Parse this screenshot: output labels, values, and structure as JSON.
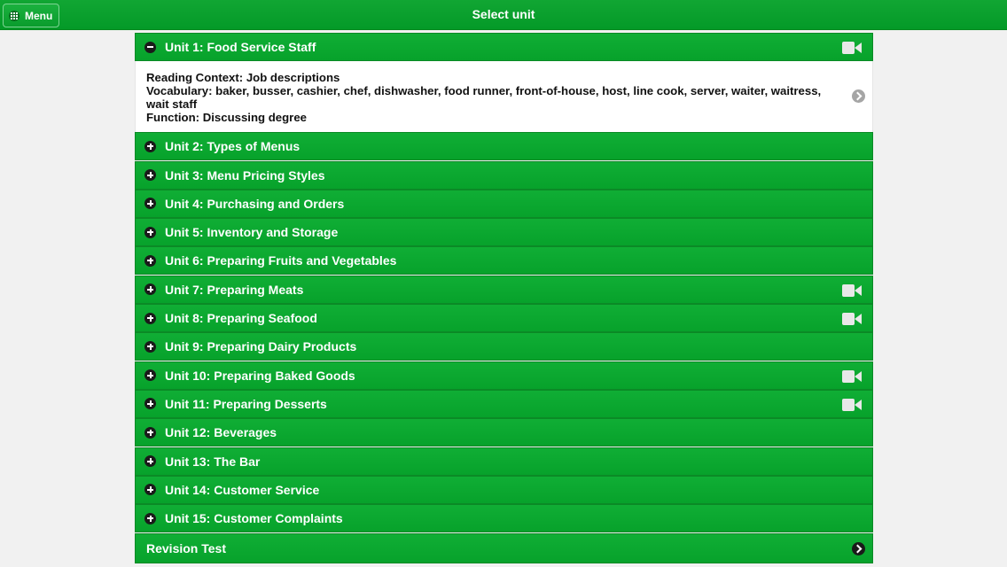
{
  "header": {
    "menu_label": "Menu",
    "title": "Select unit"
  },
  "expanded_unit": {
    "label": "Unit 1: Food Service Staff",
    "has_video": true,
    "details": [
      "Reading Context: Job descriptions",
      "Vocabulary: baker, busser, cashier, chef, dishwasher, food runner, front-of-house, host, line cook, server, waiter, waitress, wait staff",
      "Function: Discussing degree"
    ]
  },
  "units": [
    {
      "label": "Unit 2: Types of Menus",
      "has_video": false
    },
    {
      "label": "Unit 3: Menu Pricing Styles",
      "has_video": false
    },
    {
      "label": "Unit 4: Purchasing and Orders",
      "has_video": false
    },
    {
      "label": "Unit 5: Inventory and Storage",
      "has_video": false
    },
    {
      "label": "Unit 6: Preparing Fruits and Vegetables",
      "has_video": false
    },
    {
      "label": "Unit 7: Preparing Meats",
      "has_video": true
    },
    {
      "label": "Unit 8: Preparing Seafood",
      "has_video": true
    },
    {
      "label": "Unit 9: Preparing Dairy Products",
      "has_video": false
    },
    {
      "label": "Unit 10: Preparing Baked Goods",
      "has_video": true
    },
    {
      "label": "Unit 11: Preparing Desserts",
      "has_video": true
    },
    {
      "label": "Unit 12: Beverages",
      "has_video": false
    },
    {
      "label": "Unit 13: The Bar",
      "has_video": false
    },
    {
      "label": "Unit 14: Customer Service",
      "has_video": false
    },
    {
      "label": "Unit 15: Customer Complaints",
      "has_video": false
    }
  ],
  "revision": {
    "label": "Revision Test"
  },
  "icons": {
    "expand": "plus-circle-icon",
    "collapse": "minus-circle-icon",
    "video": "video-camera-icon",
    "open": "chevron-right-circle-icon"
  },
  "colors": {
    "accent": "#08a42d",
    "row_border": "#0b8a26",
    "page_background": "#f1f1f1"
  }
}
